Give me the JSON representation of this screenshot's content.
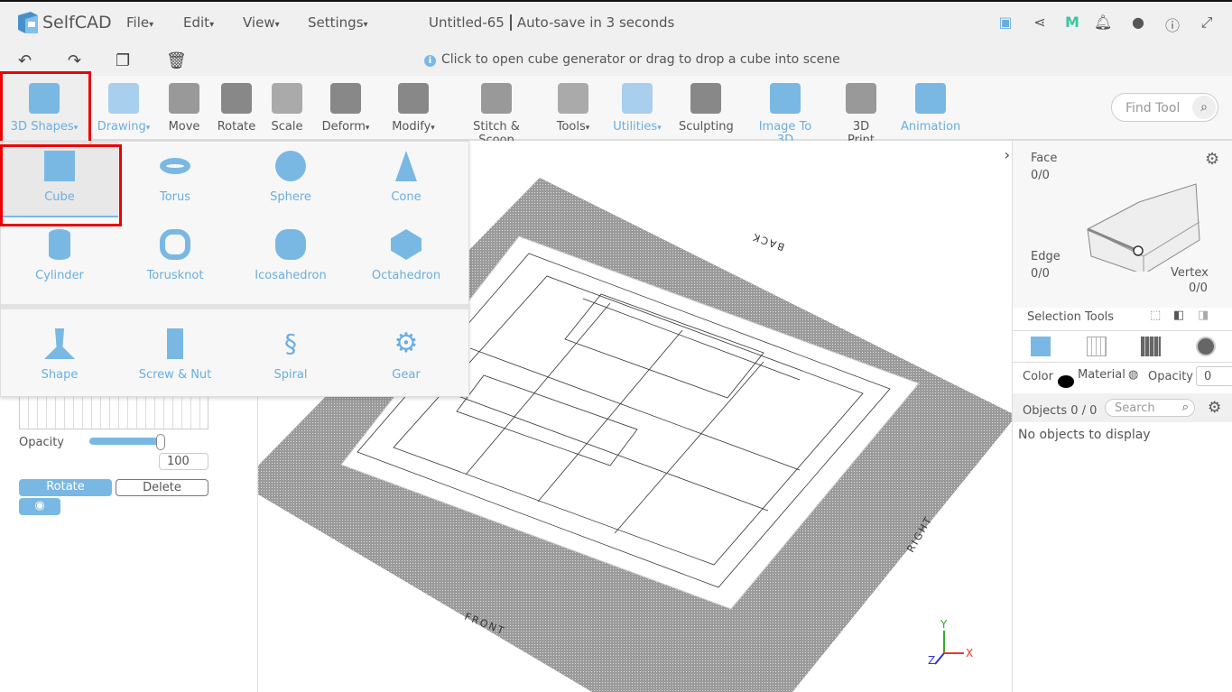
{
  "app": {
    "name": "SelfCAD",
    "doc_title": "Untitled-65",
    "autosave": "Auto-save in 3 seconds"
  },
  "menus": [
    "File",
    "Edit",
    "View",
    "Settings"
  ],
  "top_icons": [
    "save-icon",
    "share-icon",
    "m-icon",
    "bell-icon",
    "user-icon",
    "info-icon",
    "fullscreen-icon"
  ],
  "subbar": {
    "hint": "Click to open cube generator or drag to drop a cube into scene",
    "icons": [
      "undo-icon",
      "redo-icon",
      "copy-icon",
      "delete-icon"
    ]
  },
  "toolbar": {
    "tools": [
      {
        "label": "3D Shapes",
        "dropdown": true,
        "active": true
      },
      {
        "label": "Drawing",
        "dropdown": true,
        "blue": true
      },
      {
        "label": "Move"
      },
      {
        "label": "Rotate"
      },
      {
        "label": "Scale"
      },
      {
        "label": "Deform",
        "dropdown": true
      },
      {
        "label": "Modify",
        "dropdown": true
      },
      {
        "label": "Stitch & Scoop"
      },
      {
        "label": "Tools",
        "dropdown": true
      },
      {
        "label": "Utilities",
        "dropdown": true,
        "blue": true
      },
      {
        "label": "Sculpting"
      },
      {
        "label": "Image To 3D",
        "blue": true
      },
      {
        "label": "3D Print"
      },
      {
        "label": "Animation",
        "blue": true
      }
    ],
    "find_placeholder": "Find Tool"
  },
  "shapes_menu": {
    "row1": [
      "Cube",
      "Torus",
      "Sphere",
      "Cone"
    ],
    "row2": [
      "Cylinder",
      "Torusknot",
      "Icosahedron",
      "Octahedron"
    ],
    "row3": [
      "Shape",
      "Screw & Nut",
      "Spiral",
      "Gear"
    ],
    "selected": "Cube"
  },
  "left_panel": {
    "opacity_label": "Opacity",
    "opacity_value": "100",
    "opacity_fraction": 1.0,
    "rotate": "Rotate",
    "delete": "Delete"
  },
  "viewport": {
    "labels": {
      "back": "BACK",
      "right": "RIGHT",
      "front": "FRONT"
    },
    "axes": {
      "x": "X",
      "y": "Y",
      "z": "Z"
    },
    "axis_colors": {
      "x": "#e33",
      "y": "#3a3",
      "z": "#33d"
    }
  },
  "right_panel": {
    "face": "Face",
    "face_count": "0/0",
    "edge": "Edge",
    "edge_count": "0/0",
    "vertex": "Vertex",
    "vertex_count": "0/0",
    "selection_tools": "Selection Tools",
    "color": "Color",
    "material": "Material",
    "opacity": "Opacity",
    "opacity_value": "0",
    "objects": "Objects 0 / 0",
    "search_placeholder": "Search",
    "empty": "No objects to display"
  },
  "colors": {
    "accent": "#7ab8e4",
    "highlight": "#e00000"
  }
}
